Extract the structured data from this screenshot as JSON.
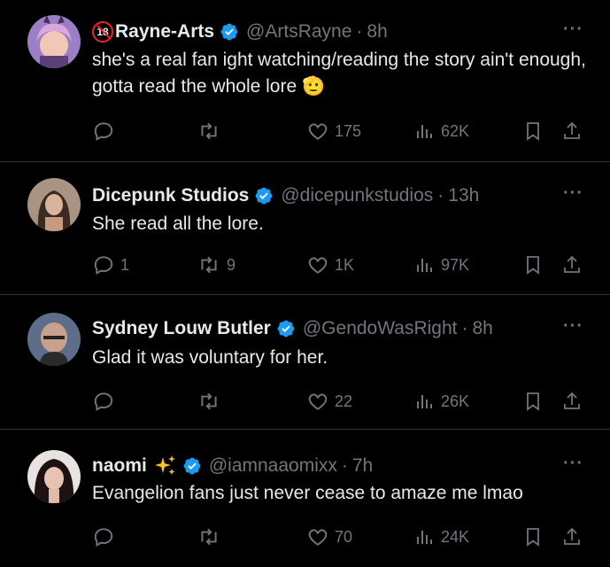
{
  "tweets": [
    {
      "name": "Rayne-Arts",
      "badge": "18",
      "handle": "@ArtsRayne",
      "time": "8h",
      "text": "she's a real fan ight watching/reading the story ain't enough, gotta read the whole lore 🫡",
      "replies": "",
      "retweets": "",
      "likes": "175",
      "views": "62K",
      "avatar_color": "#8a6cb0"
    },
    {
      "name": "Dicepunk Studios",
      "handle": "@dicepunkstudios",
      "time": "13h",
      "text": "She read all the lore.",
      "replies": "1",
      "retweets": "9",
      "likes": "1K",
      "views": "97K",
      "avatar_color": "#8c7a68"
    },
    {
      "name": "Sydney Louw Butler",
      "handle": "@GendoWasRight",
      "time": "8h",
      "text": "Glad it was voluntary for her.",
      "replies": "",
      "retweets": "",
      "likes": "22",
      "views": "26K",
      "avatar_color": "#6b5a55"
    },
    {
      "name": "naomi",
      "handle": "@iamnaaomixx",
      "time": "7h",
      "text": "Evangelion fans just never cease to amaze me lmao",
      "replies": "",
      "retweets": "",
      "likes": "70",
      "views": "24K",
      "avatar_color": "#3a2a2a"
    }
  ],
  "more_label": "···",
  "dot_separator": "·",
  "colors": {
    "background": "#000000",
    "text": "#e7e9ea",
    "muted": "#71767b",
    "verified": "#1d9bf0",
    "divider": "#2f3336"
  }
}
